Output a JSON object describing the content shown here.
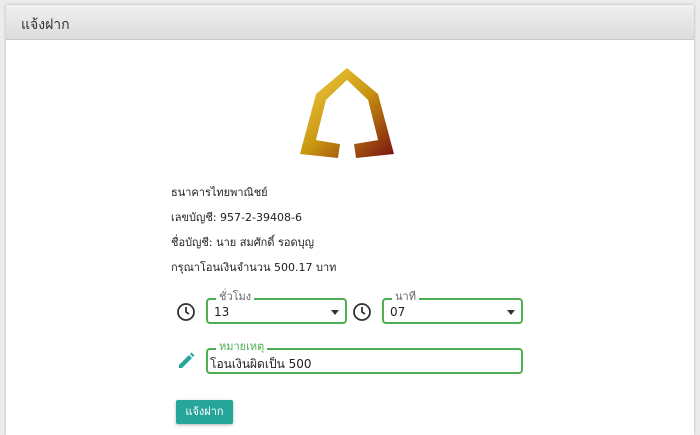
{
  "header": {
    "title": "แจ้งฝาก"
  },
  "logo": {
    "icon": "scb-bank-logo"
  },
  "info": {
    "bank_name": "ธนาคารไทยพาณิชย์",
    "account_number": "เลขบัญชี: 957-2-39408-6",
    "account_name": "ชื่อบัญชี: นาย สมศักดิ์ รอดบุญ",
    "amount_text": "กรุณาโอนเงินจำนวน 500.17 บาท"
  },
  "form": {
    "hour": {
      "label": "ชั่วโมง",
      "value": "13",
      "icon": "clock-icon"
    },
    "minute": {
      "label": "นาที",
      "value": "07",
      "icon": "clock-icon"
    },
    "note": {
      "label": "หมายเหตุ",
      "value": "โอนเงินผิดเป็น 500",
      "icon": "pencil-icon"
    },
    "submit_label": "แจ้งฝาก"
  },
  "colors": {
    "accent": "#4caf50",
    "button": "#26a69a",
    "icon": "#26a69a",
    "gold": "#d4a017"
  }
}
